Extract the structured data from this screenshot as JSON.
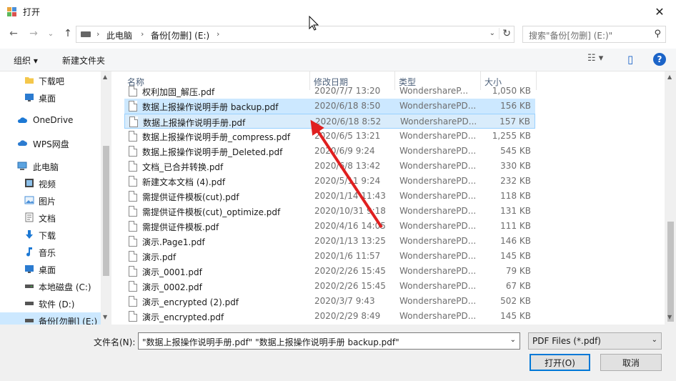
{
  "window": {
    "title": "打开",
    "close_glyph": "✕"
  },
  "nav": {
    "back_glyph": "←",
    "forward_glyph": "→",
    "recent_glyph": "⌄",
    "up_glyph": "↑",
    "crumbs": [
      "此电脑",
      "备份[勿删] (E:)"
    ],
    "crumb_sep": "›",
    "refresh_glyph": "↻",
    "search_placeholder": "搜索\"备份[勿删] (E:)\"",
    "search_glyph": "⚲"
  },
  "toolbar": {
    "organize_label": "组织 ▾",
    "new_folder_label": "新建文件夹",
    "view_glyph": "☷ ▾",
    "pane_glyph": "▯",
    "help_glyph": "?"
  },
  "sidebar": {
    "items": [
      {
        "label": "下载吧",
        "icon": "folder-icon"
      },
      {
        "label": "桌面",
        "icon": "desktop-icon"
      },
      {
        "label": "OneDrive",
        "icon": "cloud-icon"
      },
      {
        "label": "WPS网盘",
        "icon": "cloud-icon"
      },
      {
        "label": "此电脑",
        "icon": "computer-icon"
      },
      {
        "label": "视频",
        "icon": "video-icon"
      },
      {
        "label": "图片",
        "icon": "pictures-icon"
      },
      {
        "label": "文档",
        "icon": "documents-icon"
      },
      {
        "label": "下载",
        "icon": "download-icon"
      },
      {
        "label": "音乐",
        "icon": "music-icon"
      },
      {
        "label": "桌面",
        "icon": "desktop-icon"
      },
      {
        "label": "本地磁盘 (C:)",
        "icon": "drive-icon"
      },
      {
        "label": "软件 (D:)",
        "icon": "drive-icon"
      },
      {
        "label": "备份[勿删] (E:)",
        "icon": "drive-icon"
      }
    ]
  },
  "columns": {
    "name": "名称",
    "date": "修改日期",
    "type": "类型",
    "size": "大小"
  },
  "files": [
    {
      "name": "权利加固_解压.pdf",
      "date": "2020/7/7 13:20",
      "type": "WondershareP...",
      "size": "1,050 KB"
    },
    {
      "name": "数据上报操作说明手册 backup.pdf",
      "date": "2020/6/18 8:50",
      "type": "WondersharePD...",
      "size": "156 KB"
    },
    {
      "name": "数据上报操作说明手册.pdf",
      "date": "2020/6/18 8:52",
      "type": "WondersharePD...",
      "size": "157 KB"
    },
    {
      "name": "数据上报操作说明手册_compress.pdf",
      "date": "2020/6/5 13:21",
      "type": "WondersharePD...",
      "size": "1,255 KB"
    },
    {
      "name": "数据上报操作说明手册_Deleted.pdf",
      "date": "2020/6/9 9:24",
      "type": "WondersharePD...",
      "size": "545 KB"
    },
    {
      "name": "文档_已合并转换.pdf",
      "date": "2020/6/8 13:42",
      "type": "WondersharePD...",
      "size": "330 KB"
    },
    {
      "name": "新建文本文档 (4).pdf",
      "date": "2020/5/11 9:24",
      "type": "WondersharePD...",
      "size": "232 KB"
    },
    {
      "name": "需提供证件模板(cut).pdf",
      "date": "2020/1/14 11:43",
      "type": "WondersharePD...",
      "size": "118 KB"
    },
    {
      "name": "需提供证件模板(cut)_optimize.pdf",
      "date": "2020/10/31 9:18",
      "type": "WondersharePD...",
      "size": "131 KB"
    },
    {
      "name": "需提供证件模板.pdf",
      "date": "2020/4/16 14:05",
      "type": "WondersharePD...",
      "size": "111 KB"
    },
    {
      "name": "演示.Page1.pdf",
      "date": "2020/1/13 13:25",
      "type": "WondersharePD...",
      "size": "146 KB"
    },
    {
      "name": "演示.pdf",
      "date": "2020/1/6 11:57",
      "type": "WondersharePD...",
      "size": "145 KB"
    },
    {
      "name": "演示_0001.pdf",
      "date": "2020/2/26 15:45",
      "type": "WondersharePD...",
      "size": "79 KB"
    },
    {
      "name": "演示_0002.pdf",
      "date": "2020/2/26 15:45",
      "type": "WondersharePD...",
      "size": "67 KB"
    },
    {
      "name": "演示_encrypted (2).pdf",
      "date": "2020/3/7 9:43",
      "type": "WondersharePD...",
      "size": "502 KB"
    },
    {
      "name": "演示_encrypted.pdf",
      "date": "2020/2/29 8:49",
      "type": "WondersharePD...",
      "size": "145 KB"
    }
  ],
  "bottom": {
    "filename_label": "文件名(N):",
    "filename_value": "\"数据上报操作说明手册.pdf\" \"数据上报操作说明手册 backup.pdf\"",
    "filetype_value": "PDF Files (*.pdf)",
    "open_label": "打开(O)",
    "cancel_label": "取消",
    "dd_glyph": "⌄"
  },
  "colors": {
    "selection": "#cce8ff",
    "accent": "#0078d7",
    "annotation_arrow": "#e02020"
  }
}
